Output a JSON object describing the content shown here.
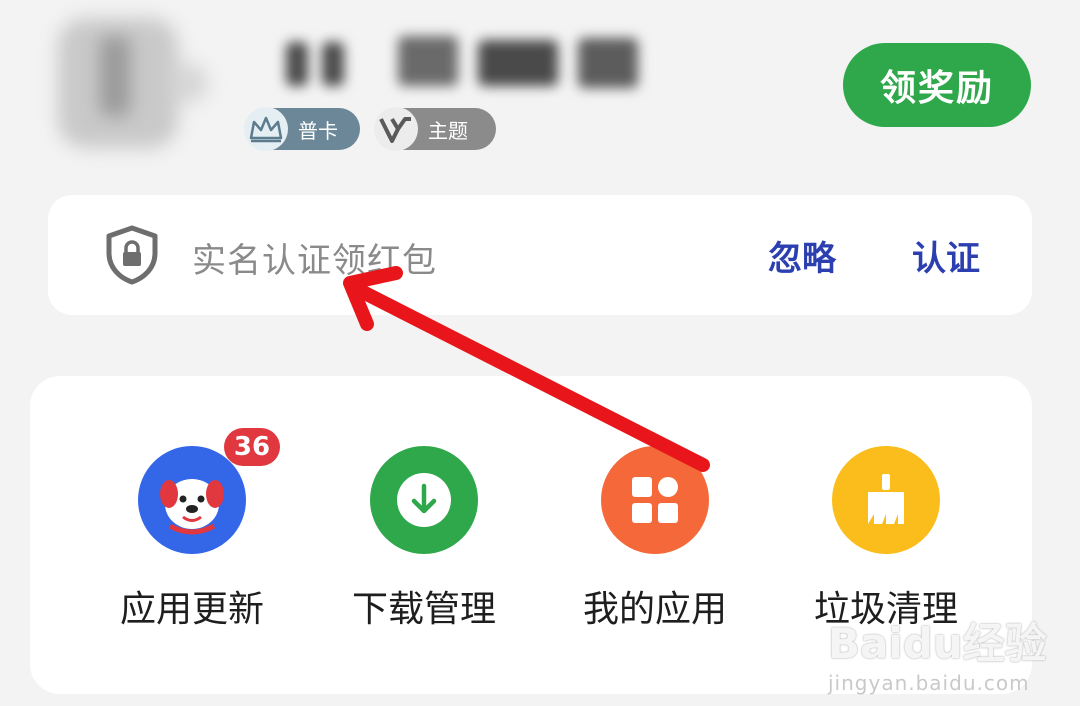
{
  "header": {
    "reward_button": "领奖励",
    "badges": [
      {
        "label": "普卡",
        "icon": "crown-icon"
      },
      {
        "label": "主题",
        "icon": "v-logo-icon"
      }
    ]
  },
  "verify_card": {
    "text": "实名认证领红包",
    "ignore_label": "忽略",
    "verify_label": "认证",
    "icon": "shield-lock-icon"
  },
  "shortcuts": [
    {
      "label": "应用更新",
      "icon": "mascot-dog-icon",
      "badge": "36",
      "color": "#3466e8"
    },
    {
      "label": "下载管理",
      "icon": "download-icon",
      "color": "#2ea84a"
    },
    {
      "label": "我的应用",
      "icon": "apps-grid-icon",
      "color": "#f4683a"
    },
    {
      "label": "垃圾清理",
      "icon": "broom-icon",
      "color": "#fbbd1c"
    }
  ],
  "colors": {
    "accent_green": "#2ea84a",
    "link_blue": "#2b3fb0",
    "badge_red": "#e0383e",
    "annotation_red": "#e8161b"
  },
  "watermark": {
    "main": "Baidu经验",
    "url": "jingyan.baidu.com"
  }
}
